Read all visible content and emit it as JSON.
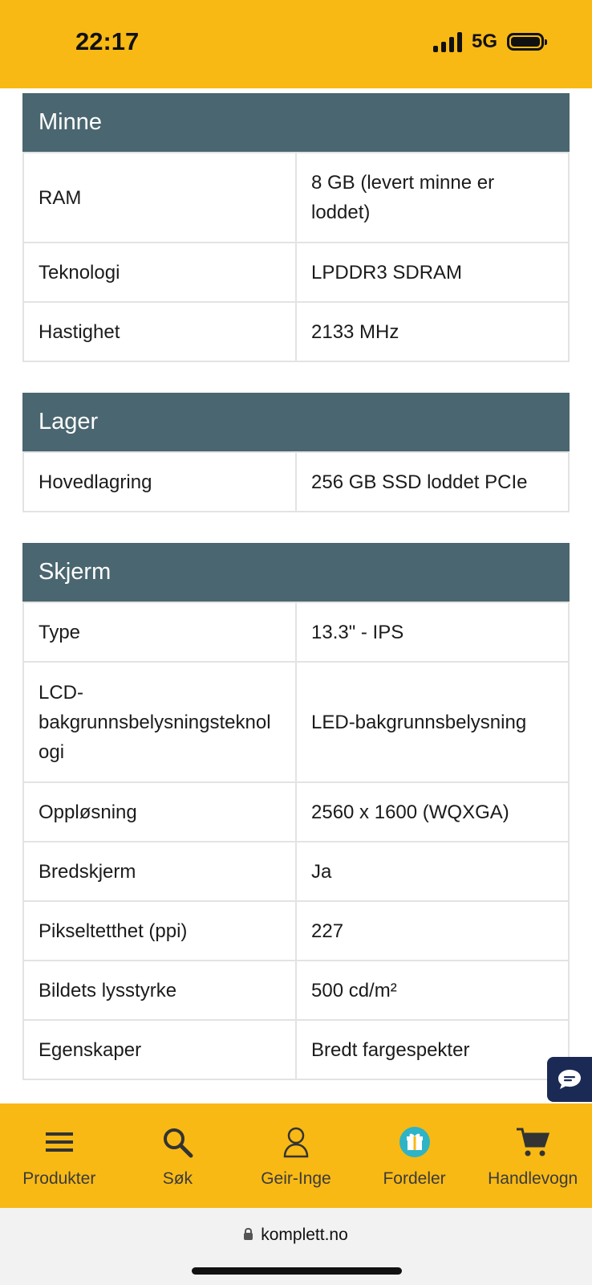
{
  "status_bar": {
    "time": "22:17",
    "network": "5G",
    "signal_bars": 4,
    "battery_level": 1.0
  },
  "sections": [
    {
      "title": "Minne",
      "rows": [
        {
          "key": "RAM",
          "value": "8 GB (levert minne er loddet)"
        },
        {
          "key": "Teknologi",
          "value": "LPDDR3 SDRAM"
        },
        {
          "key": "Hastighet",
          "value": "2133 MHz"
        }
      ]
    },
    {
      "title": "Lager",
      "rows": [
        {
          "key": "Hovedlagring",
          "value": "256 GB SSD loddet PCIe"
        }
      ]
    },
    {
      "title": "Skjerm",
      "rows": [
        {
          "key": "Type",
          "value": "13.3\" - IPS"
        },
        {
          "key": "LCD-bakgrunnsbelysningsteknologi",
          "value": "LED-bakgrunnsbelysning"
        },
        {
          "key": "Oppløsning",
          "value": "2560 x 1600 (WQXGA)"
        },
        {
          "key": "Bredskjerm",
          "value": "Ja"
        },
        {
          "key": "Pikseltetthet (ppi)",
          "value": "227"
        },
        {
          "key": "Bildets lysstyrke",
          "value": "500 cd/m²"
        },
        {
          "key": "Egenskaper",
          "value": "Bredt fargespekter"
        }
      ]
    }
  ],
  "bottom_nav": [
    {
      "label": "Produkter",
      "icon": "menu-icon"
    },
    {
      "label": "Søk",
      "icon": "search-icon"
    },
    {
      "label": "Geir-Inge",
      "icon": "user-icon"
    },
    {
      "label": "Fordeler",
      "icon": "gift-icon"
    },
    {
      "label": "Handlevogn",
      "icon": "cart-icon"
    }
  ],
  "browser": {
    "url": "komplett.no"
  },
  "colors": {
    "brand_yellow": "#f8b914",
    "section_header": "#4a6670",
    "chat_bubble": "#1b2a55",
    "gift_accent": "#2fb3c6"
  }
}
